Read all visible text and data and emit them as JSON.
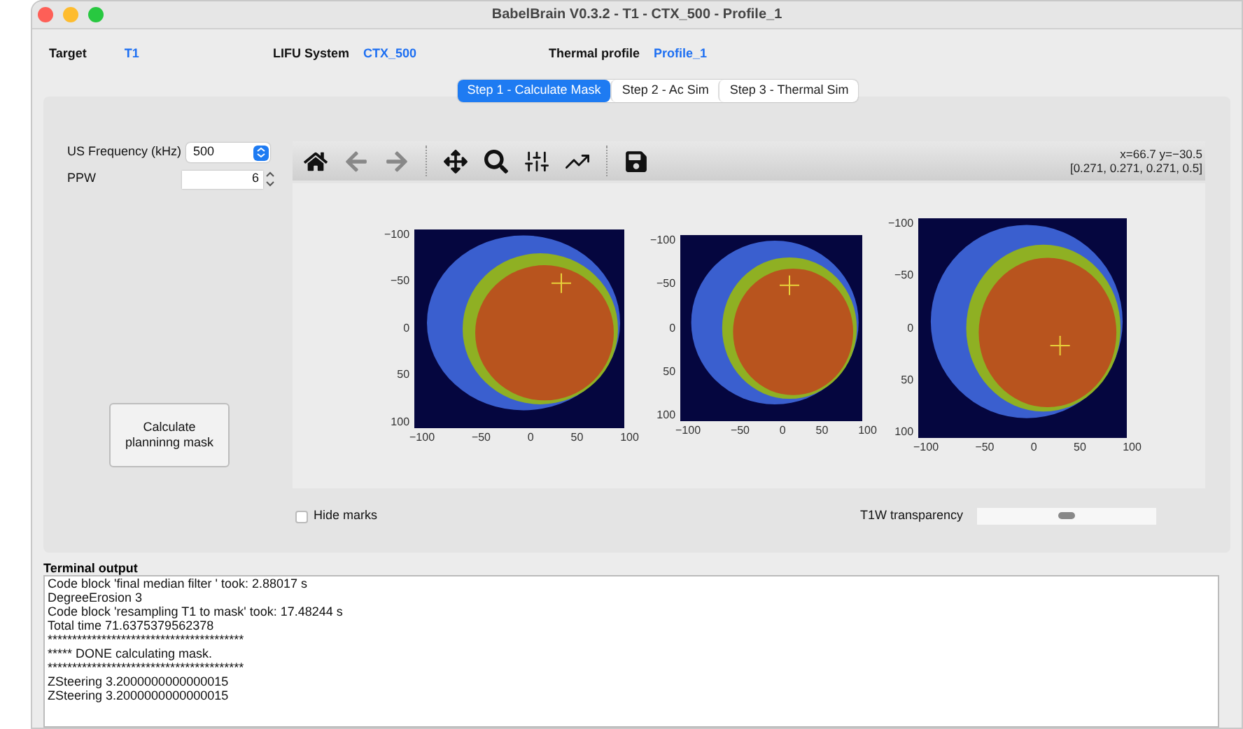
{
  "window": {
    "title": "BabelBrain V0.3.2 - T1 - CTX_500 - Profile_1"
  },
  "header": [
    {
      "label": "Target",
      "value": "T1"
    },
    {
      "label": "LIFU System",
      "value": "CTX_500"
    },
    {
      "label": "Thermal profile",
      "value": "Profile_1"
    }
  ],
  "tabs": [
    {
      "label": "Step 1 - Calculate Mask",
      "selected": true
    },
    {
      "label": "Step 2 - Ac Sim",
      "selected": false
    },
    {
      "label": "Step 3 - Thermal Sim",
      "selected": false
    }
  ],
  "frequency": {
    "label": "US Frequency (kHz)",
    "value": "500"
  },
  "ppw": {
    "label": "PPW",
    "value": "6"
  },
  "calculate_button": "Calculate planninng mask",
  "coords": [
    "x=66.7 y=−30.5",
    "[0.271, 0.271, 0.271, 0.5]"
  ],
  "plots": [
    {
      "yticks": [
        "−100",
        "−50",
        "0",
        "50",
        "100"
      ],
      "xticks": [
        "−100",
        "−50",
        "0",
        "50",
        "100"
      ]
    },
    {
      "yticks": [
        "−100",
        "−50",
        "0",
        "50",
        "100"
      ],
      "xticks": [
        "−100",
        "−50",
        "0",
        "50",
        "100"
      ]
    },
    {
      "yticks": [
        "−100",
        "−50",
        "0",
        "50",
        "100"
      ],
      "xticks": [
        "−100",
        "−50",
        "0",
        "50",
        "100"
      ]
    }
  ],
  "hide_marks": {
    "label": "Hide marks",
    "checked": false
  },
  "transparency": {
    "label": "T1W transparency",
    "level": 0.5
  },
  "terminal": {
    "title": "Terminal output",
    "lines": [
      "Code block 'final median filter ' took: 2.88017 s",
      "DegreeErosion 3",
      "Code block 'resampling T1 to mask' took: 17.48244 s",
      "Total time 71.6375379562378",
      "****************************************",
      "***** DONE calculating mask.",
      "****************************************",
      "ZSteering 3.2000000000000015",
      "ZSteering 3.2000000000000015"
    ]
  }
}
